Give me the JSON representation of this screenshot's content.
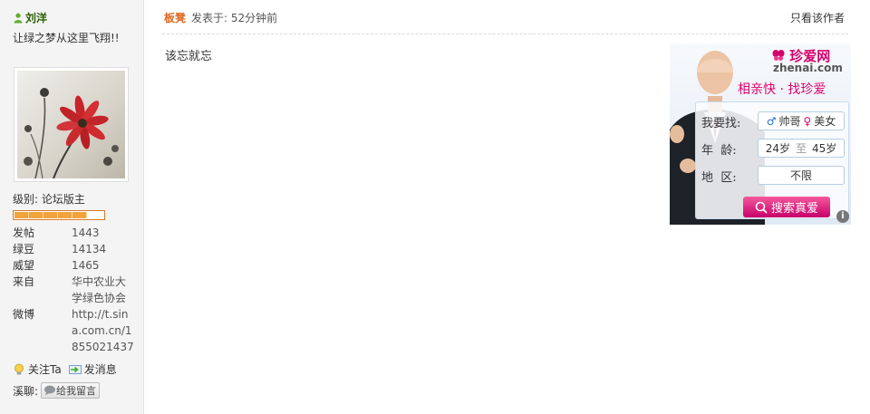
{
  "user": {
    "name": "刘洋",
    "signature": "让绿之梦从这里飞翔!!",
    "level_label": "级别: 论坛版主",
    "level_segments": 5,
    "stats": [
      {
        "label": "发帖",
        "value": "1443"
      },
      {
        "label": "绿豆",
        "value": "14134"
      },
      {
        "label": "威望",
        "value": "1465"
      },
      {
        "label": "来自",
        "value": "华中农业大学绿色协会"
      },
      {
        "label": "微博",
        "value": "http://t.sina.com.cn/1855021437"
      }
    ],
    "follow_label": "关注Ta",
    "message_label": "发消息",
    "xiliao_label": "溪聊:",
    "leave_message_label": "给我留言"
  },
  "post": {
    "author": "板凳",
    "time": "发表于: 52分钟前",
    "only_author": "只看该作者",
    "body": "该忘就忘"
  },
  "ad": {
    "logo": "珍爱网",
    "domain": "zhenai.com",
    "slogan": "相亲快 · 找珍爱",
    "find_label": "我要找:",
    "find_male": "帅哥",
    "find_female": "美女",
    "age_label": "年  龄:",
    "age_from": "24岁",
    "age_to_word": "至",
    "age_to": "45岁",
    "region_label": "地  区:",
    "region_value": "不限",
    "search_label": "搜索真爱",
    "info_icon": "i"
  }
}
